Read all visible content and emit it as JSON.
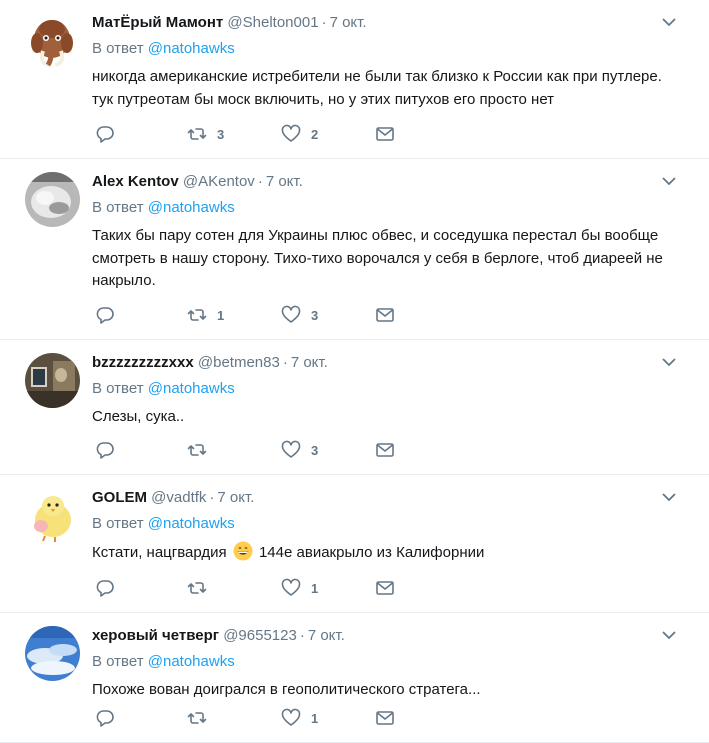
{
  "tweets": [
    {
      "fullname": "МатЁрый Мамонт",
      "handle": "@Shelton001",
      "time": "7 окт.",
      "reply_prefix": "В ответ",
      "reply_mention": "@natohawks",
      "text": "никогда американские истребители не были так близко к России как при путлере. тук путреотам бы моск включить, но у этих питухов его просто нет",
      "retweets": "3",
      "likes": "2",
      "avatar_icon": "mammoth-avatar"
    },
    {
      "fullname": "Alex Kentov",
      "handle": "@AKentov",
      "time": "7 окт.",
      "reply_prefix": "В ответ",
      "reply_mention": "@natohawks",
      "text": "Таких бы пару сотен для Украины плюс обвес, и соседушка перестал бы вообще смотреть в нашу сторону. Тихо-тихо ворочался у себя в берлоге, чтоб диареей не накрыло.",
      "retweets": "1",
      "likes": "3",
      "avatar_icon": "grey-photo-avatar"
    },
    {
      "fullname": "bzzzzzzzzzxxx",
      "handle": "@betmen83",
      "time": "7 окт.",
      "reply_prefix": "В ответ",
      "reply_mention": "@natohawks",
      "text": "Слезы, сука..",
      "retweets": "",
      "likes": "3",
      "avatar_icon": "room-photo-avatar"
    },
    {
      "fullname": "GOLEM",
      "handle": "@vadtfk",
      "time": "7 окт.",
      "reply_prefix": "В ответ",
      "reply_mention": "@natohawks",
      "text_before": "Кстати, нацгвардия",
      "text_after": "144е авиакрыло из Калифорнии",
      "retweets": "",
      "likes": "1",
      "avatar_icon": "chick-avatar"
    },
    {
      "fullname": "херовый четверг",
      "handle": "@9655123",
      "time": "7 окт.",
      "reply_prefix": "В ответ",
      "reply_mention": "@natohawks",
      "text": "Похоже вован доигрался в геополитического стратега...",
      "retweets": "",
      "likes": "1",
      "avatar_icon": "sky-avatar"
    }
  ],
  "colors": {
    "accent": "#1da1f2",
    "muted": "#657786",
    "text": "#14171a",
    "divider": "#e6ecf0"
  },
  "icons": {
    "reply": "reply-icon",
    "retweet": "retweet-icon",
    "like": "heart-icon",
    "dm": "envelope-icon",
    "caret": "chevron-down-icon"
  }
}
